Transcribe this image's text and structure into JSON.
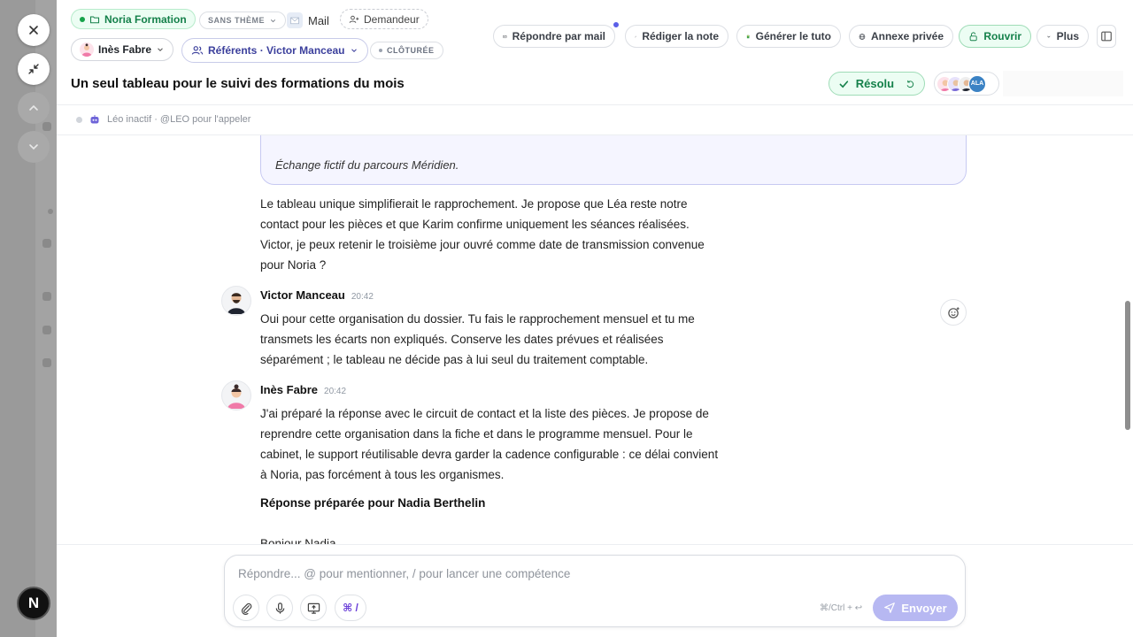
{
  "header": {
    "org_chip": "Noria Formation",
    "theme_chip": "SANS THÈME",
    "channel": "Mail",
    "requester_chip": "Demandeur",
    "assignee": "Inès Fabre",
    "referents": "Référents · Victor Manceau",
    "status_chip": "CLÔTURÉE",
    "actions": {
      "reply_mail": "Répondre par mail",
      "write_note": "Rédiger la note",
      "gen_tuto": "Générer le tuto",
      "private_annex": "Annexe privée",
      "reopen": "Rouvrir",
      "more": "Plus"
    },
    "title": "Un seul tableau pour le suivi des formations du mois",
    "resolved": "Résolu",
    "participant_badge": "ALA"
  },
  "leo_status": "Léo inactif · @LEO pour l'appeler",
  "feed": {
    "quote_text": "Échange fictif du parcours Méridien.",
    "para1": [
      "Le tableau unique simplifierait le rapprochement. Je propose que Léa reste notre",
      "contact pour les pièces et que Karim confirme uniquement les séances réalisées.",
      "Victor, je peux retenir le troisième jour ouvré comme date de transmission convenue",
      "pour Noria ?"
    ],
    "msg1": {
      "author": "Victor Manceau",
      "time": "20:42",
      "lines": [
        "Oui pour cette organisation du dossier. Tu fais le rapprochement mensuel et tu me",
        "transmets les écarts non expliqués. Conserve les dates prévues et réalisées",
        "séparément ; le tableau ne décide pas à lui seul du traitement comptable."
      ]
    },
    "msg2": {
      "author": "Inès Fabre",
      "time": "20:42",
      "lines": [
        "J'ai préparé la réponse avec le circuit de contact et la liste des pièces. Je propose de",
        "reprendre cette organisation dans la fiche et dans le programme mensuel. Pour le",
        "cabinet, le support réutilisable devra garder la cadence configurable : ce délai convient",
        "à Noria, pas forcément à tous les organismes."
      ],
      "heading": "Réponse préparée pour Nadia Berthelin",
      "cut_line": "Bonjour Nadia,"
    }
  },
  "composer": {
    "placeholder": "Répondre... @ pour mentionner, / pour lancer une compétence",
    "cmd": "⌘ /",
    "hint": "⌘/Ctrl + ↩",
    "send": "Envoyer"
  },
  "app_logo": "N",
  "colors": {
    "accent_green": "#14804a",
    "accent_violet": "#5b5fe8",
    "send_disabled": "#b7b8f2"
  }
}
